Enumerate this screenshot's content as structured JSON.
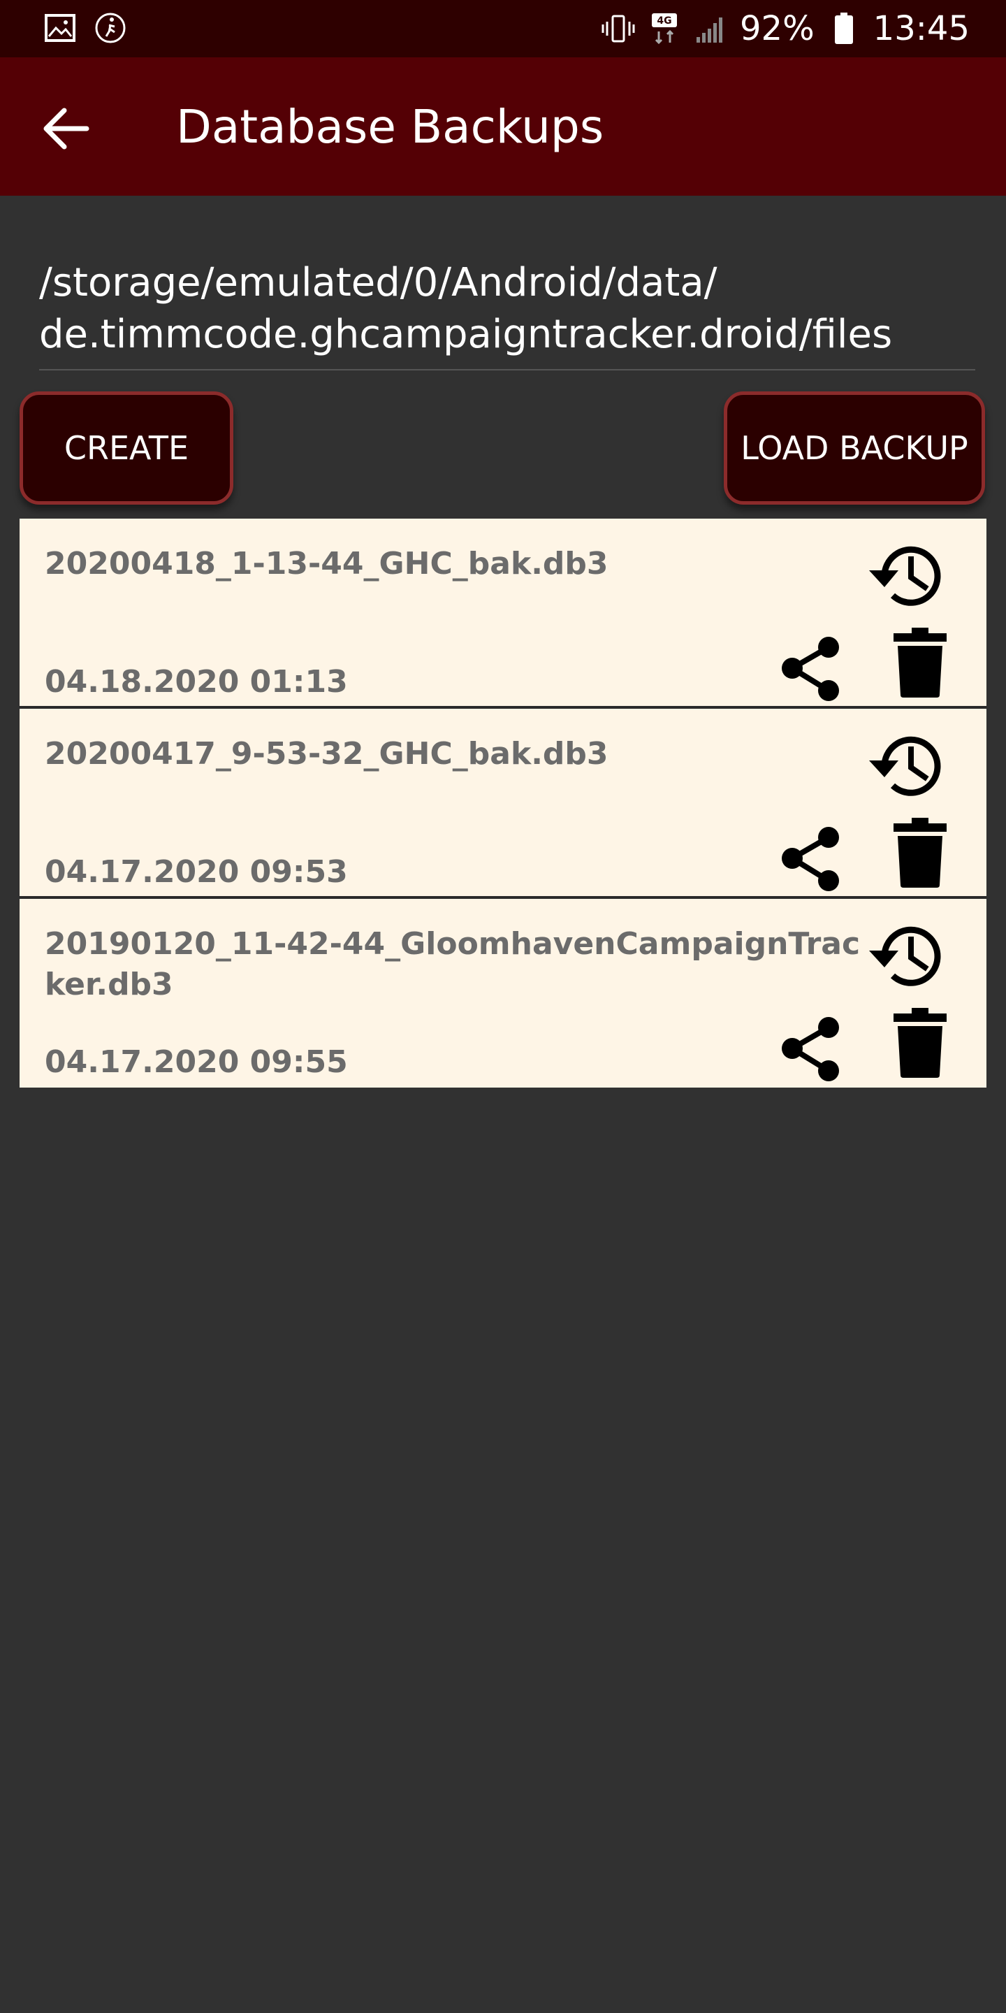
{
  "status_bar": {
    "battery": "92%",
    "time": "13:45",
    "network": "4G"
  },
  "app_bar": {
    "title": "Database Backups"
  },
  "path": {
    "line1": "/storage/emulated/0/Android/data/",
    "line2": "de.timmcode.ghcampaigntracker.droid/files"
  },
  "buttons": {
    "create": "CREATE",
    "load_backup": "LOAD BACKUP"
  },
  "backups": [
    {
      "name": "20200418_1-13-44_GHC_bak.db3",
      "date": "04.18.2020 01:13"
    },
    {
      "name": "20200417_9-53-32_GHC_bak.db3",
      "date": "04.17.2020 09:53"
    },
    {
      "name": "20190120_11-42-44_GloomhavenCampaignTracker.db3",
      "date": "04.17.2020 09:55"
    }
  ],
  "colors": {
    "status_bar": "#2e0000",
    "app_bar": "#540005",
    "background": "#313131",
    "list_item": "#fef5e6",
    "button_fill": "#2b0000",
    "button_border": "#8c2b2b"
  },
  "icons": [
    "gallery-icon",
    "accessibility-icon",
    "vibrate-icon",
    "signal-icon",
    "battery-icon",
    "back-arrow-icon",
    "restore-history-icon",
    "share-icon",
    "delete-icon"
  ]
}
